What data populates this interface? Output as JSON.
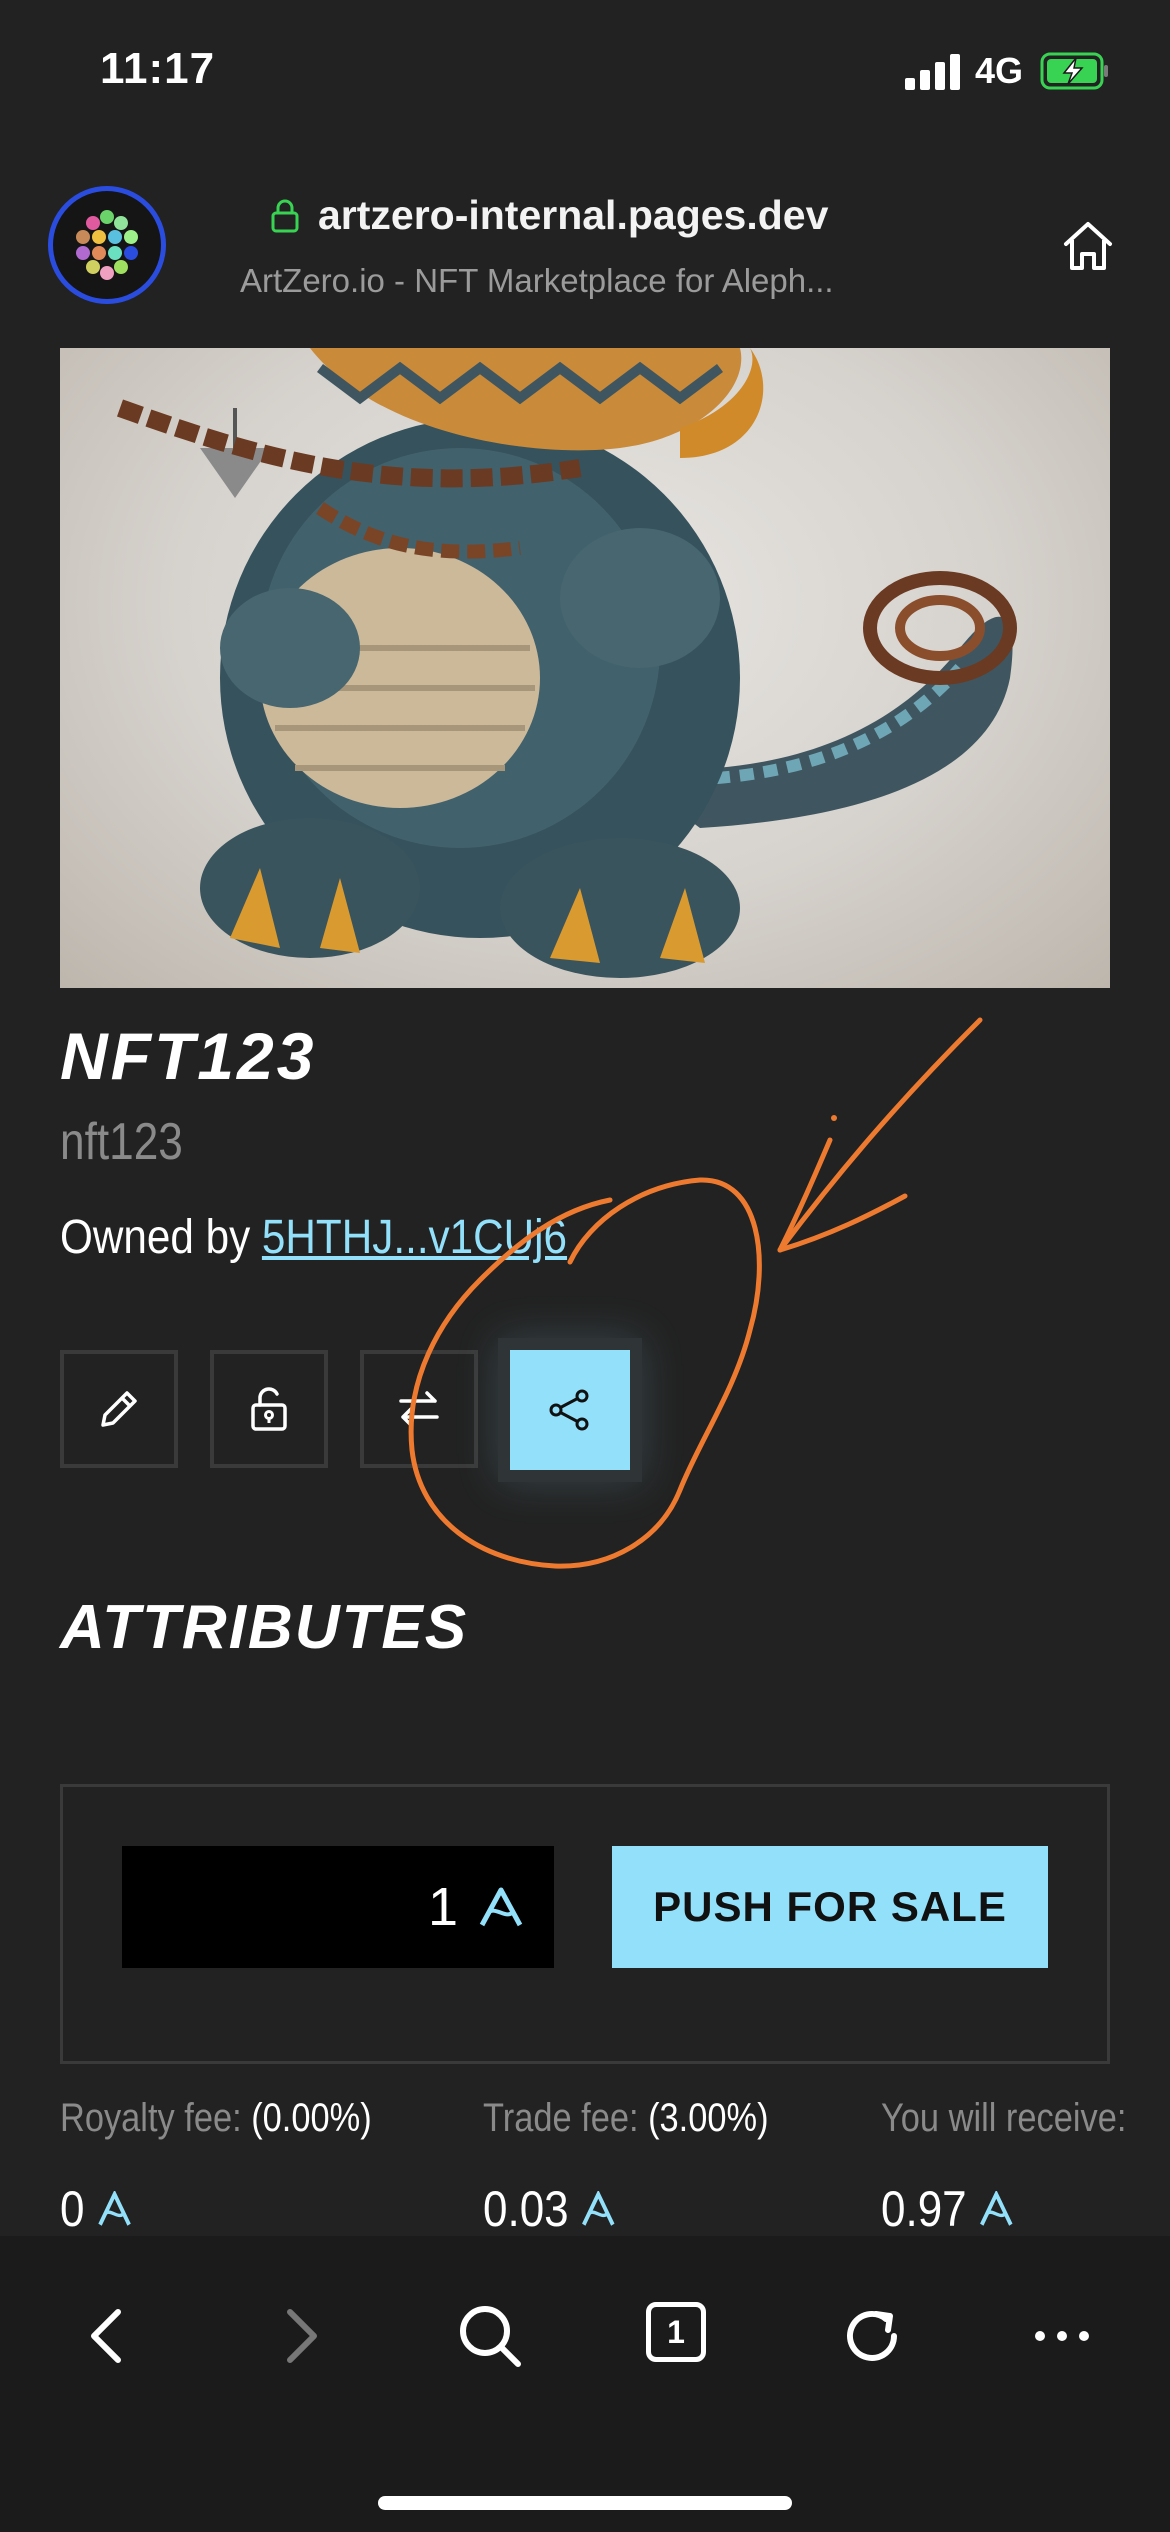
{
  "status_bar": {
    "time": "11:17",
    "network": "4G"
  },
  "browser": {
    "url": "artzero-internal.pages.dev",
    "page_title": "ArtZero.io - NFT Marketplace for Aleph..."
  },
  "nft": {
    "title": "NFT123",
    "subtitle": "nft123",
    "owned_by_label": "Owned by ",
    "owner": "5HTHJ...v1CUj6"
  },
  "attributes_title": "ATTRIBUTES",
  "sale": {
    "price_value": "1",
    "push_label": "PUSH FOR SALE"
  },
  "fees": {
    "royalty_label": "Royalty fee: ",
    "royalty_pct": "(0.00%)",
    "royalty_value": "0",
    "trade_label": "Trade fee: ",
    "trade_pct": "(3.00%)",
    "trade_value": "0.03",
    "receive_label": "You will receive:",
    "receive_value": "0.97"
  },
  "toolbar": {
    "tabs_count": "1"
  },
  "colors": {
    "accent": "#93e0fb",
    "background": "#222222",
    "annotation": "#ee7a30"
  },
  "icons": [
    "lock-icon",
    "home-icon",
    "edit-icon",
    "unlock-icon",
    "transfer-icon",
    "share-icon",
    "azero-icon",
    "back-icon",
    "forward-icon",
    "search-icon",
    "tabs-icon",
    "reload-icon",
    "more-icon"
  ]
}
